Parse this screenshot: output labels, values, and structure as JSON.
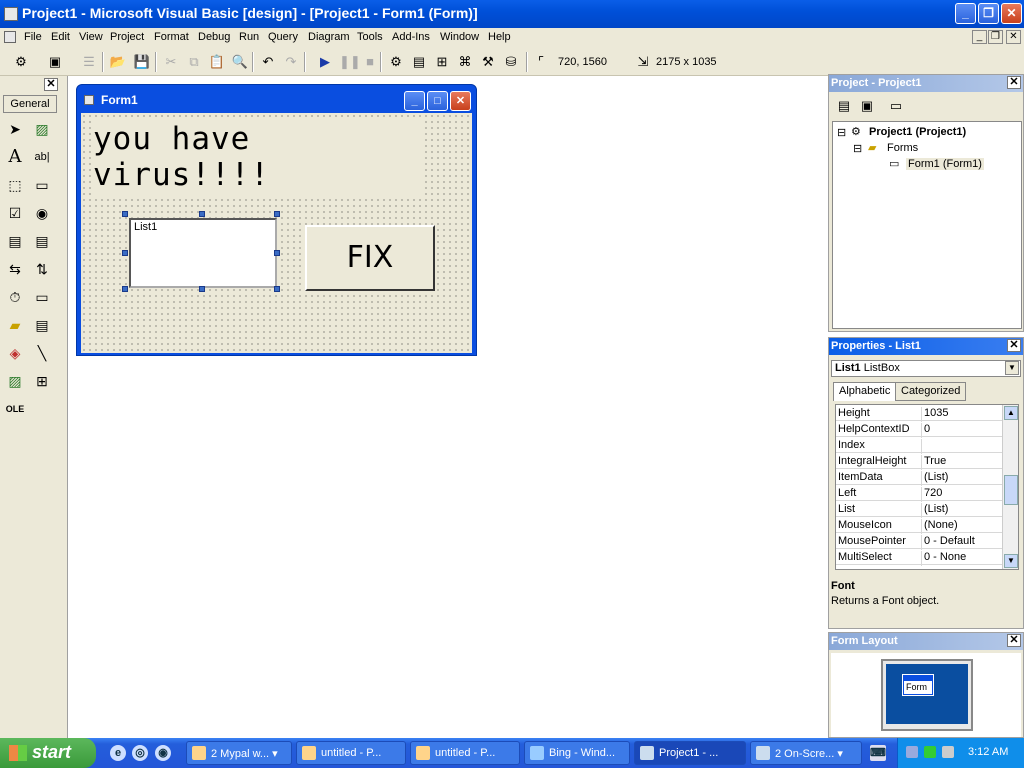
{
  "window": {
    "title": "Project1 - Microsoft Visual Basic [design] - [Project1 - Form1 (Form)]"
  },
  "menu": [
    "File",
    "Edit",
    "View",
    "Project",
    "Format",
    "Debug",
    "Run",
    "Query",
    "Diagram",
    "Tools",
    "Add-Ins",
    "Window",
    "Help"
  ],
  "toolbar": {
    "position": "720, 1560",
    "size": "2175 x 1035"
  },
  "toolbox": {
    "tab_label": "General"
  },
  "form": {
    "title": "Form1",
    "label_line1": "you have",
    "label_line2": "virus!!!!",
    "listbox_item": "List1",
    "button_caption": "FIX"
  },
  "project_panel": {
    "title": "Project - Project1",
    "root": "Project1 (Project1)",
    "folder": "Forms",
    "item": "Form1 (Form1)"
  },
  "properties_panel": {
    "title": "Properties - List1",
    "object_name": "List1",
    "object_type": "ListBox",
    "tabs": [
      "Alphabetic",
      "Categorized"
    ],
    "rows": [
      {
        "name": "Height",
        "value": "1035"
      },
      {
        "name": "HelpContextID",
        "value": "0"
      },
      {
        "name": "Index",
        "value": ""
      },
      {
        "name": "IntegralHeight",
        "value": "True"
      },
      {
        "name": "ItemData",
        "value": "(List)"
      },
      {
        "name": "Left",
        "value": "720"
      },
      {
        "name": "List",
        "value": "(List)"
      },
      {
        "name": "MouseIcon",
        "value": "(None)"
      },
      {
        "name": "MousePointer",
        "value": "0 - Default"
      },
      {
        "name": "MultiSelect",
        "value": "0 - None"
      }
    ],
    "desc_title": "Font",
    "desc_text": "Returns a Font object."
  },
  "form_layout": {
    "title": "Form Layout",
    "mini_label": "Form"
  },
  "taskbar": {
    "start": "start",
    "tasks": [
      "2 Mypal w...",
      "untitled - P...",
      "untitled - P...",
      "Bing - Wind...",
      "Project1 - ...",
      "2 On-Scre..."
    ],
    "clock": "3:12 AM"
  },
  "colors": {
    "titlebar": "#0050d8",
    "face": "#ece9d8",
    "taskbar": "#245edb",
    "start": "#3a9a3a"
  }
}
